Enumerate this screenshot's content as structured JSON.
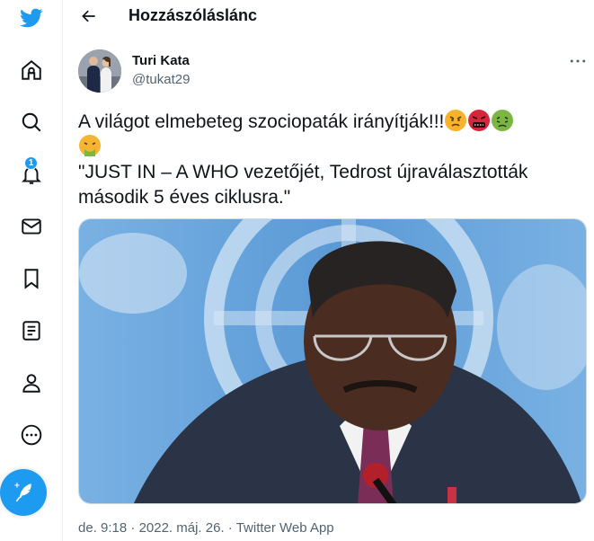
{
  "header": {
    "title": "Hozzászóláslánc",
    "back_icon": "arrow-left-icon"
  },
  "sidebar": {
    "items": [
      {
        "icon": "twitter-logo-icon"
      },
      {
        "icon": "home-icon"
      },
      {
        "icon": "explore-icon"
      },
      {
        "icon": "notifications-icon",
        "badge": "1"
      },
      {
        "icon": "messages-icon"
      },
      {
        "icon": "bookmarks-icon"
      },
      {
        "icon": "lists-icon"
      },
      {
        "icon": "profile-icon"
      },
      {
        "icon": "more-icon"
      }
    ],
    "compose_icon": "compose-tweet-icon"
  },
  "tweet": {
    "author_name": "Turi Kata",
    "author_handle": "@tukat29",
    "text_line1": "A világot elmebeteg szociopaták irányítják!!!",
    "text_line3": "\"JUST IN – A WHO vezetőjét, Tedrost újraválasztották második 5 éves ciklusra.\"",
    "emojis": [
      "angry-face",
      "face-with-symbols-on-mouth",
      "nauseated-face",
      "face-vomiting"
    ],
    "time": "de. 9:18",
    "date": "2022. máj. 26.",
    "separator": "·",
    "source": "Twitter Web App"
  },
  "colors": {
    "accent": "#1d9bf0",
    "text": "#0f1419",
    "secondary": "#536471"
  }
}
